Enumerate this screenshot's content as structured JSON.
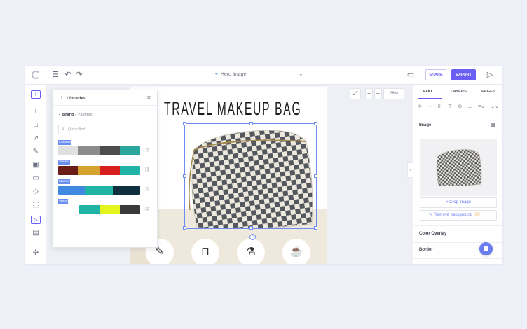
{
  "document": {
    "title": "Hero Image"
  },
  "toolbar": {
    "share_label": "SHARE",
    "export_label": "EXPORT"
  },
  "libraries": {
    "title": "Libraries",
    "breadcrumb_parent": "Brand",
    "breadcrumb_separator": "/",
    "breadcrumb_current": "Palettes",
    "search_placeholder": "Quick find",
    "palettes": [
      {
        "name": "Chrome",
        "colors": [
          "#e0e0e0",
          "#8c8c8a",
          "#4d4d4d",
          "#2aa69c"
        ]
      },
      {
        "name": "Sunset",
        "colors": [
          "#6a1c16",
          "#d6a42e",
          "#d81e1e",
          "#1fb4a6"
        ]
      },
      {
        "name": "Marine",
        "colors": [
          "#3f89e0",
          "#1fb4a6",
          "#0f2f3e"
        ]
      },
      {
        "name": "Weed",
        "colors": [
          "#1fb4a6",
          "#e3f51a",
          "#3a3a3a"
        ]
      }
    ]
  },
  "canvas": {
    "headline": "TRAVEL MAKEUP BAG",
    "zoom": "28%",
    "icons": [
      "makeup-brush-icon",
      "tube-icon",
      "brushes-cup-icon",
      "jar-icon"
    ]
  },
  "properties": {
    "tabs": [
      "EDIT",
      "LAYERS",
      "PAGES"
    ],
    "active_tab": "EDIT",
    "image_section": "Image",
    "crop_label": "Crop image",
    "remove_bg_label": "Remove background",
    "color_overlay_label": "Color Overlay",
    "border_label": "Border"
  },
  "colors": {
    "accent": "#6a5ff2",
    "selection": "#6f8cf2"
  }
}
